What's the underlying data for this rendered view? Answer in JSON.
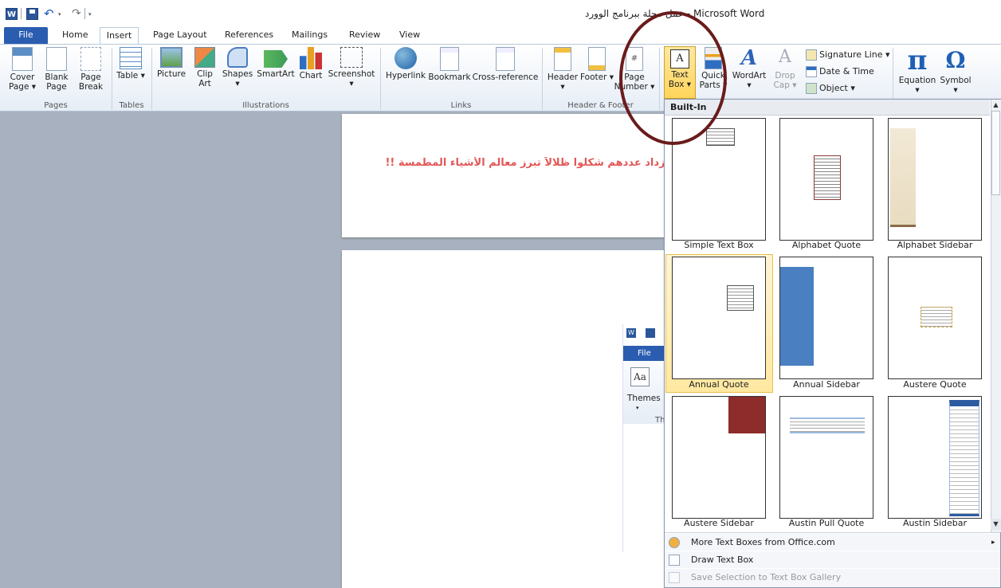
{
  "window": {
    "title": "عمل مجلة ببرنامج الوورد  -  Microsoft Word",
    "logo": "W"
  },
  "qat": {
    "icons": [
      "word-logo-icon",
      "save-icon",
      "undo-icon",
      "redo-icon",
      "customize-icon"
    ],
    "undo": "↶",
    "redo": "↷",
    "dd": "▾"
  },
  "tabs": [
    "File",
    "Home",
    "Insert",
    "Page Layout",
    "References",
    "Mailings",
    "Review",
    "View"
  ],
  "ribbon": {
    "pages": {
      "label": "Pages",
      "cover": "Cover Page ▾",
      "blank": "Blank Page",
      "break": "Page Break"
    },
    "tables": {
      "label": "Tables",
      "table": "Table ▾"
    },
    "illustrations": {
      "label": "Illustrations",
      "picture": "Picture",
      "clipart": "Clip Art",
      "shapes": "Shapes ▾",
      "smartart": "SmartArt",
      "chart": "Chart",
      "screenshot": "Screenshot ▾"
    },
    "links": {
      "label": "Links",
      "hyperlink": "Hyperlink",
      "bookmark": "Bookmark",
      "crossref": "Cross-reference"
    },
    "header_footer": {
      "label": "Header & Footer",
      "header": "Header ▾",
      "footer": "Footer ▾",
      "pagenum": "Page Number ▾",
      "pagenum_glyph": "#"
    },
    "text": {
      "textbox": "Text Box ▾",
      "textbox_glyph": "A",
      "quickparts": "Quick Parts ▾",
      "wordart": "WordArt ▾",
      "wordart_glyph": "A",
      "dropcap": "Drop Cap ▾",
      "dropcap_glyph": "A",
      "sigline": "Signature Line ▾",
      "datetime": "Date & Time",
      "object": "Object ▾"
    },
    "symbols": {
      "equation": "Equation ▾",
      "symbol": "Symbol ▾",
      "pi": "π",
      "omega": "Ω"
    }
  },
  "document": {
    "arabic_line": "يزداد عددهم شكلوا ظلالاً تبرز معالم الأشياء المطمسة !!"
  },
  "embedded": {
    "file": "File",
    "themes": "Themes",
    "themes_dd": "▾",
    "group": "Th",
    "themes_glyph": "Aa"
  },
  "gallery": {
    "header": "Built-In",
    "tiles": [
      {
        "label": "Simple Text Box"
      },
      {
        "label": "Alphabet Quote"
      },
      {
        "label": "Alphabet Sidebar"
      },
      {
        "label": "Annual Quote"
      },
      {
        "label": "Annual Sidebar"
      },
      {
        "label": "Austere Quote"
      },
      {
        "label": "Austere Sidebar"
      },
      {
        "label": "Austin Pull Quote"
      },
      {
        "label": "Austin Sidebar"
      }
    ],
    "menu": {
      "more": "More Text Boxes from Office.com",
      "draw": "Draw Text Box",
      "save": "Save Selection to Text Box Gallery",
      "arrow": "▸"
    },
    "scroll": {
      "up": "▲",
      "down": "▼"
    }
  },
  "colors": {
    "accent": "#2a5db0",
    "annotation": "#6a1b1b",
    "doc_text": "#e25757",
    "selection": "#ffe8a0"
  }
}
